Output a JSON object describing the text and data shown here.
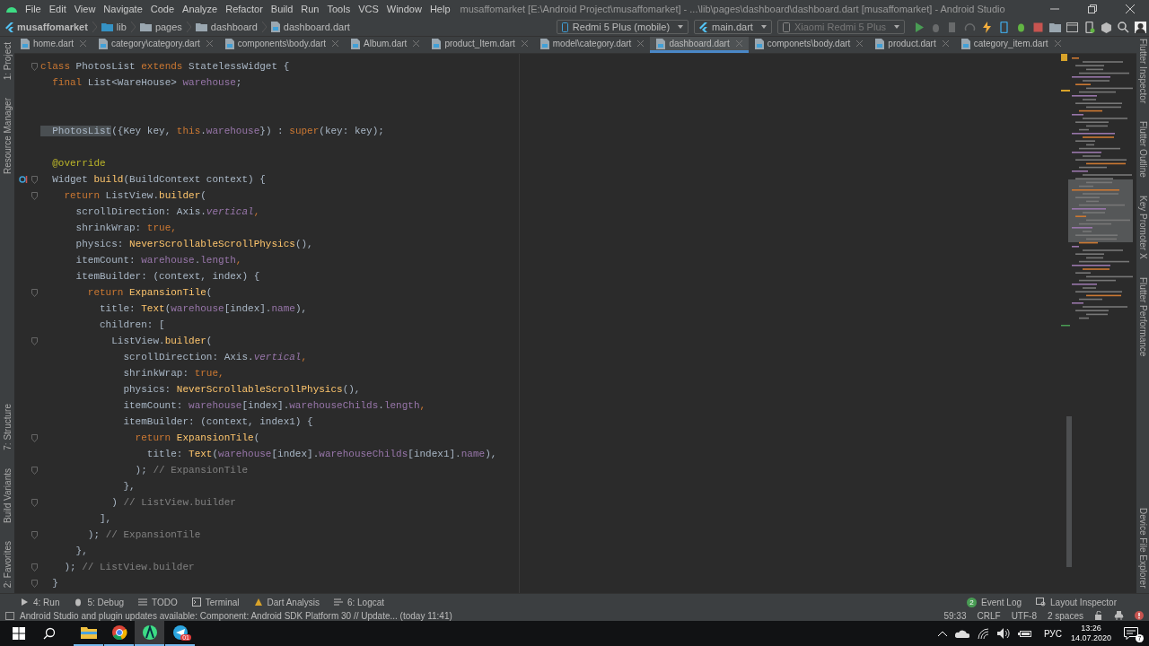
{
  "menu_bar": {
    "items": [
      "File",
      "Edit",
      "View",
      "Navigate",
      "Code",
      "Analyze",
      "Refactor",
      "Build",
      "Run",
      "Tools",
      "VCS",
      "Window",
      "Help"
    ],
    "title": "musaffomarket [E:\\Android Project\\musaffomarket] - ...\\lib\\pages\\dashboard\\dashboard.dart [musaffomarket] - Android Studio"
  },
  "breadcrumbs": [
    {
      "label": "musaffomarket",
      "kind": "project"
    },
    {
      "label": "lib",
      "kind": "source"
    },
    {
      "label": "pages",
      "kind": "folder"
    },
    {
      "label": "dashboard",
      "kind": "folder"
    },
    {
      "label": "dashboard.dart",
      "kind": "file"
    }
  ],
  "run_toolbar": {
    "device": "Redmi 5 Plus (mobile)",
    "config": "main.dart",
    "target": {
      "label": "Xiaomi Redmi 5 Plus",
      "disabled": true
    },
    "buttons": [
      {
        "kind": "run",
        "disabled": false
      },
      {
        "kind": "debug",
        "disabled": true
      },
      {
        "kind": "coverage",
        "disabled": true
      },
      {
        "kind": "attach",
        "disabled": true
      },
      {
        "kind": "reload",
        "disabled": false
      },
      {
        "kind": "phone",
        "disabled": false
      },
      {
        "kind": "bug",
        "disabled": false
      },
      {
        "kind": "stop",
        "disabled": false
      },
      {
        "kind": "folder",
        "disabled": false
      },
      {
        "kind": "window",
        "disabled": false
      },
      {
        "kind": "avd",
        "disabled": false
      },
      {
        "kind": "sdk",
        "disabled": false
      },
      {
        "kind": "search",
        "disabled": false
      },
      {
        "kind": "user",
        "disabled": false
      }
    ]
  },
  "tabs": [
    {
      "label": "home.dart",
      "selected": false
    },
    {
      "label": "category\\category.dart",
      "selected": false
    },
    {
      "label": "components\\body.dart",
      "selected": false
    },
    {
      "label": "Album.dart",
      "selected": false
    },
    {
      "label": "product_Item.dart",
      "selected": false
    },
    {
      "label": "model\\category.dart",
      "selected": false
    },
    {
      "label": "dashboard.dart",
      "selected": true
    },
    {
      "label": "componets\\body.dart",
      "selected": false
    },
    {
      "label": "product.dart",
      "selected": false
    },
    {
      "label": "category_item.dart",
      "selected": false
    }
  ],
  "left_tools": {
    "top": [
      "1: Project",
      "Resource Manager"
    ],
    "bottom": [
      "7: Structure",
      "Build Variants",
      "2: Favorites"
    ]
  },
  "right_tools": {
    "top": [
      "Flutter Inspector",
      "Flutter Outline",
      "Key Promoter X",
      "Flutter Performance"
    ],
    "bottom": [
      "Device File Explorer"
    ]
  },
  "editor": {
    "lines": [
      {
        "fold": true,
        "tokens": [
          {
            "text": "class",
            "kind": "keyword"
          },
          {
            "text": " PhotosList ",
            "kind": "plain"
          },
          {
            "text": "extends",
            "kind": "keyword"
          },
          {
            "text": " StatelessWidget {",
            "kind": "plain"
          }
        ]
      },
      {
        "fold": false,
        "tokens": [
          {
            "text": "  final",
            "kind": "keyword"
          },
          {
            "text": " List<WareHouse> ",
            "kind": "plain"
          },
          {
            "text": "warehouse",
            "kind": "field"
          },
          {
            "text": ";",
            "kind": "plain"
          }
        ]
      },
      {
        "fold": false
      },
      {
        "fold": false
      },
      {
        "fold": false,
        "tokens": [
          {
            "text": "  PhotosList",
            "kind": "match"
          },
          {
            "text": "({Key key, ",
            "kind": "plain"
          },
          {
            "text": "this",
            "kind": "keyword"
          },
          {
            "text": ".",
            "kind": "plain"
          },
          {
            "text": "warehouse",
            "kind": "field"
          },
          {
            "text": "}) : ",
            "kind": "plain"
          },
          {
            "text": "super",
            "kind": "keyword"
          },
          {
            "text": "(key: key);",
            "kind": "plain"
          }
        ]
      },
      {
        "fold": false
      },
      {
        "fold": false,
        "tokens": [
          {
            "text": "  @override",
            "kind": "annotation"
          }
        ]
      },
      {
        "fold": true,
        "overrides": true,
        "tokens": [
          {
            "text": "  Widget ",
            "kind": "plain"
          },
          {
            "text": "build",
            "kind": "call"
          },
          {
            "text": "(BuildContext context) {",
            "kind": "plain"
          }
        ]
      },
      {
        "fold": true,
        "tokens": [
          {
            "text": "    return",
            "kind": "keyword"
          },
          {
            "text": " ListView.",
            "kind": "plain"
          },
          {
            "text": "builder",
            "kind": "call"
          },
          {
            "text": "(",
            "kind": "plain"
          }
        ]
      },
      {
        "fold": false,
        "tokens": [
          {
            "text": "      scrollDirection: Axis.",
            "kind": "plain"
          },
          {
            "text": "vertical",
            "kind": "static"
          },
          {
            "text": ",",
            "kind": "keyword"
          }
        ]
      },
      {
        "fold": false,
        "tokens": [
          {
            "text": "      shrinkWrap: ",
            "kind": "plain"
          },
          {
            "text": "true",
            "kind": "keyword"
          },
          {
            "text": ",",
            "kind": "keyword"
          }
        ]
      },
      {
        "fold": false,
        "tokens": [
          {
            "text": "      physics: ",
            "kind": "plain"
          },
          {
            "text": "NeverScrollableScrollPhysics",
            "kind": "call"
          },
          {
            "text": "(),",
            "kind": "plain"
          }
        ]
      },
      {
        "fold": false,
        "tokens": [
          {
            "text": "      itemCount: ",
            "kind": "plain"
          },
          {
            "text": "warehouse",
            "kind": "field"
          },
          {
            "text": ".",
            "kind": "plain"
          },
          {
            "text": "length",
            "kind": "field"
          },
          {
            "text": ",",
            "kind": "keyword"
          }
        ]
      },
      {
        "fold": false,
        "tokens": [
          {
            "text": "      itemBuilder: (context, index) {",
            "kind": "plain"
          }
        ]
      },
      {
        "fold": true,
        "tokens": [
          {
            "text": "        return",
            "kind": "keyword"
          },
          {
            "text": " ExpansionTile",
            "kind": "call"
          },
          {
            "text": "(",
            "kind": "plain"
          }
        ]
      },
      {
        "fold": false,
        "tokens": [
          {
            "text": "          title: ",
            "kind": "plain"
          },
          {
            "text": "Text",
            "kind": "call"
          },
          {
            "text": "(",
            "kind": "plain"
          },
          {
            "text": "warehouse",
            "kind": "field"
          },
          {
            "text": "[index].",
            "kind": "plain"
          },
          {
            "text": "name",
            "kind": "field"
          },
          {
            "text": "),",
            "kind": "plain"
          }
        ]
      },
      {
        "fold": false,
        "tokens": [
          {
            "text": "          children: [",
            "kind": "plain"
          }
        ]
      },
      {
        "fold": true,
        "tokens": [
          {
            "text": "            ListView.",
            "kind": "plain"
          },
          {
            "text": "builder",
            "kind": "call"
          },
          {
            "text": "(",
            "kind": "plain"
          }
        ]
      },
      {
        "fold": false,
        "tokens": [
          {
            "text": "              scrollDirection: Axis.",
            "kind": "plain"
          },
          {
            "text": "vertical",
            "kind": "static"
          },
          {
            "text": ",",
            "kind": "keyword"
          }
        ]
      },
      {
        "fold": false,
        "tokens": [
          {
            "text": "              shrinkWrap: ",
            "kind": "plain"
          },
          {
            "text": "true",
            "kind": "keyword"
          },
          {
            "text": ",",
            "kind": "keyword"
          }
        ]
      },
      {
        "fold": false,
        "tokens": [
          {
            "text": "              physics: ",
            "kind": "plain"
          },
          {
            "text": "NeverScrollableScrollPhysics",
            "kind": "call"
          },
          {
            "text": "(),",
            "kind": "plain"
          }
        ]
      },
      {
        "fold": false,
        "tokens": [
          {
            "text": "              itemCount: ",
            "kind": "plain"
          },
          {
            "text": "warehouse",
            "kind": "field"
          },
          {
            "text": "[index].",
            "kind": "plain"
          },
          {
            "text": "warehouseChilds",
            "kind": "field"
          },
          {
            "text": ".",
            "kind": "plain"
          },
          {
            "text": "length",
            "kind": "field"
          },
          {
            "text": ",",
            "kind": "keyword"
          }
        ]
      },
      {
        "fold": false,
        "tokens": [
          {
            "text": "              itemBuilder: (context, index1) {",
            "kind": "plain"
          }
        ]
      },
      {
        "fold": true,
        "tokens": [
          {
            "text": "                return",
            "kind": "keyword"
          },
          {
            "text": " ExpansionTile",
            "kind": "call"
          },
          {
            "text": "(",
            "kind": "plain"
          }
        ]
      },
      {
        "fold": false,
        "tokens": [
          {
            "text": "                  title: ",
            "kind": "plain"
          },
          {
            "text": "Text",
            "kind": "call"
          },
          {
            "text": "(",
            "kind": "plain"
          },
          {
            "text": "warehouse",
            "kind": "field"
          },
          {
            "text": "[index].",
            "kind": "plain"
          },
          {
            "text": "warehouseChilds",
            "kind": "field"
          },
          {
            "text": "[index1].",
            "kind": "plain"
          },
          {
            "text": "name",
            "kind": "field"
          },
          {
            "text": "),",
            "kind": "plain"
          }
        ]
      },
      {
        "fold": true,
        "tokens": [
          {
            "text": "                ); ",
            "kind": "plain"
          },
          {
            "text": "// ExpansionTile",
            "kind": "comment"
          }
        ]
      },
      {
        "fold": false,
        "tokens": [
          {
            "text": "              },",
            "kind": "plain"
          }
        ]
      },
      {
        "fold": true,
        "tokens": [
          {
            "text": "            ) ",
            "kind": "plain"
          },
          {
            "text": "// ListView.builder",
            "kind": "comment"
          }
        ]
      },
      {
        "fold": false,
        "tokens": [
          {
            "text": "          ],",
            "kind": "plain"
          }
        ]
      },
      {
        "fold": true,
        "tokens": [
          {
            "text": "        ); ",
            "kind": "plain"
          },
          {
            "text": "// ExpansionTile",
            "kind": "comment"
          }
        ]
      },
      {
        "fold": false,
        "tokens": [
          {
            "text": "      },",
            "kind": "plain"
          }
        ]
      },
      {
        "fold": true,
        "tokens": [
          {
            "text": "    ); ",
            "kind": "plain"
          },
          {
            "text": "// ListView.builder",
            "kind": "comment"
          }
        ]
      },
      {
        "fold": true,
        "tokens": [
          {
            "text": "  }",
            "kind": "plain"
          }
        ]
      }
    ]
  },
  "tool_windows": {
    "left": [
      {
        "label": "4: Run",
        "kind": "run"
      },
      {
        "label": "5: Debug",
        "kind": "debug"
      },
      {
        "label": "TODO",
        "kind": "list"
      },
      {
        "label": "Terminal",
        "kind": "terminal"
      },
      {
        "label": "Dart Analysis",
        "kind": "analysis"
      },
      {
        "label": "6: Logcat",
        "kind": "logcat"
      }
    ],
    "right": [
      {
        "label": "Event Log",
        "badge": "2"
      },
      {
        "label": "Layout Inspector"
      }
    ]
  },
  "status_bar": {
    "message": "Android Studio and plugin updates available: Component: Android SDK Platform 30 // Update... (today 11:41)",
    "items": [
      "59:33",
      "CRLF",
      "UTF-8",
      "2 spaces"
    ]
  },
  "taskbar": {
    "apps": [
      {
        "kind": "explorer",
        "selected": false
      },
      {
        "kind": "chrome",
        "selected": false
      },
      {
        "kind": "studio",
        "selected": true
      },
      {
        "kind": "telegram",
        "selected": false,
        "badge": "01"
      }
    ],
    "language": "РУС",
    "time": "13:26",
    "date": "14.07.2020",
    "notifications": "7"
  }
}
